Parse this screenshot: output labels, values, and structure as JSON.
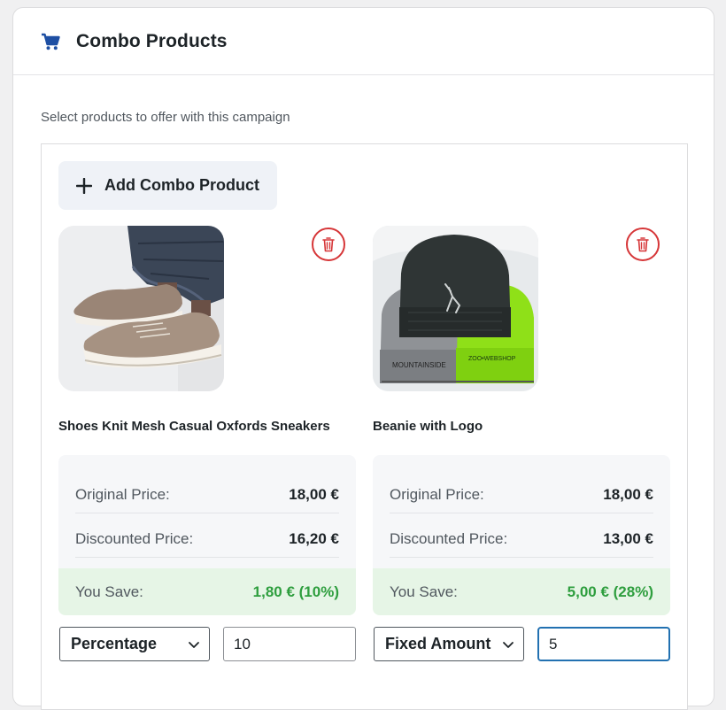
{
  "header": {
    "title": "Combo Products",
    "icon": "cart-icon",
    "icon_color": "#1e4fa3"
  },
  "subtitle": "Select products to offer with this campaign",
  "add_button": {
    "label": "Add Combo Product",
    "icon": "plus-icon"
  },
  "products": [
    {
      "name": "Shoes Knit Mesh Casual Oxfords Sneakers",
      "image": "sneakers-product-image",
      "original_label": "Original Price:",
      "original_price": "18,00 €",
      "discounted_label": "Discounted Price:",
      "discounted_price": "16,20 €",
      "save_label": "You Save:",
      "save_value": "1,80 € (10%)",
      "discount_type": "Percentage",
      "discount_value": "10"
    },
    {
      "name": "Beanie with Logo",
      "image": "beanie-product-image",
      "original_label": "Original Price:",
      "original_price": "18,00 €",
      "discounted_label": "Discounted Price:",
      "discounted_price": "13,00 €",
      "save_label": "You Save:",
      "save_value": "5,00 € (28%)",
      "discount_type": "Fixed Amount",
      "discount_value": "5"
    }
  ],
  "colors": {
    "delete": "#d63638",
    "savings_text": "#2e9e3e",
    "savings_bg": "#e6f5e6",
    "focus": "#2271b1"
  }
}
